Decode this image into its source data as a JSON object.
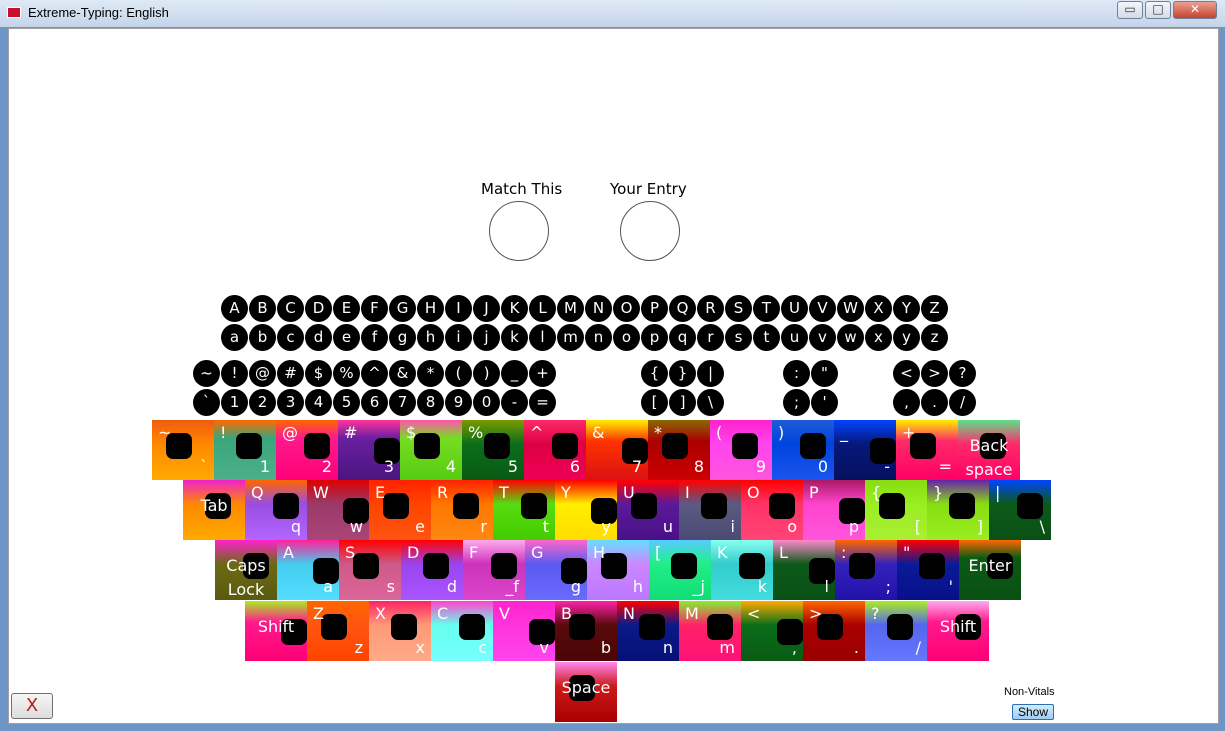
{
  "window": {
    "title": "Extreme-Typing: English",
    "minimize_label": "▭",
    "maximize_label": "□",
    "close_label": "✕"
  },
  "labels": {
    "match_this": "Match This",
    "your_entry": "Your Entry"
  },
  "reference_rows": {
    "upper": [
      "A",
      "B",
      "C",
      "D",
      "E",
      "F",
      "G",
      "H",
      "I",
      "J",
      "K",
      "L",
      "M",
      "N",
      "O",
      "P",
      "Q",
      "R",
      "S",
      "T",
      "U",
      "V",
      "W",
      "X",
      "Y",
      "Z"
    ],
    "lower": [
      "a",
      "b",
      "c",
      "d",
      "e",
      "f",
      "g",
      "h",
      "i",
      "j",
      "k",
      "l",
      "m",
      "n",
      "o",
      "p",
      "q",
      "r",
      "s",
      "t",
      "u",
      "v",
      "w",
      "x",
      "y",
      "z"
    ],
    "sym_shift": [
      "~",
      "!",
      "@",
      "#",
      "$",
      "%",
      "^",
      "&",
      "*",
      "(",
      ")",
      "_",
      "+"
    ],
    "sym_base": [
      "`",
      "1",
      "2",
      "3",
      "4",
      "5",
      "6",
      "7",
      "8",
      "9",
      "0",
      "-",
      "="
    ],
    "bracket_shift": [
      "{",
      "}",
      "|"
    ],
    "bracket_base": [
      "[",
      "]",
      "\\"
    ],
    "semi_shift": [
      ":",
      "\""
    ],
    "semi_base": [
      ";",
      "'"
    ],
    "comma_shift": [
      "<",
      ">",
      "?"
    ],
    "comma_base": [
      ",",
      ".",
      "/"
    ]
  },
  "keyboard_rows": [
    [
      {
        "shift": "~",
        "base": "`",
        "bg": "linear-gradient(180deg,#f05a10 0%,#ff8800 40%,#ffaa00 100%)"
      },
      {
        "shift": "!",
        "base": "1",
        "bg": "linear-gradient(180deg,#ff6a00 0%,#3aa57a 30%,#4cb08a 100%)"
      },
      {
        "shift": "@",
        "base": "2",
        "bg": "linear-gradient(180deg,#ff6600 0%,#ff1a8c 30%,#ff0077 100%)"
      },
      {
        "shift": "#",
        "base": "3",
        "bg": "linear-gradient(180deg,#ff3399 0%,#6a1fa0 30%,#4b1580 100%)"
      },
      {
        "shift": "$",
        "base": "4",
        "bg": "linear-gradient(180deg,#ff55aa 0%,#77dd22 30%,#55cc11 100%)"
      },
      {
        "shift": "%",
        "base": "5",
        "bg": "linear-gradient(180deg,#7a9a00 0%,#0b6e1a 40%,#0a5a14 100%)"
      },
      {
        "shift": "^",
        "base": "6",
        "bg": "linear-gradient(180deg,#ff2a6a 0%,#dd0044 40%,#ee0055 100%)"
      },
      {
        "shift": "&",
        "base": "7",
        "bg": "linear-gradient(180deg,#ffee00 0%,#ff3300 35%,#dd1111 100%)"
      },
      {
        "shift": "*",
        "base": "8",
        "bg": "linear-gradient(180deg,#8a6a00 0%,#aa0000 35%,#cc0000 100%)"
      },
      {
        "shift": "(",
        "base": "9",
        "bg": "linear-gradient(180deg,#ff22cc 0%,#ff44ee 40%,#ff55dd 100%)"
      },
      {
        "shift": ")",
        "base": "0",
        "bg": "linear-gradient(180deg,#1e5bd6 0%,#0044dd 40%,#1a55ee 100%)"
      },
      {
        "shift": "_",
        "base": "-",
        "bg": "linear-gradient(180deg,#0044ff 0%,#06187a 40%,#061060 100%)"
      },
      {
        "shift": "+",
        "base": "=",
        "bg": "linear-gradient(180deg,#ffee00 0%,#ff2a6a 35%,#ff0066 100%)"
      },
      {
        "label": "Back space",
        "bg": "linear-gradient(180deg,#5fe08a 0%,#ff2a6a 40%,#ff0066 100%)"
      }
    ],
    [
      {
        "label": "Tab",
        "bg": "linear-gradient(180deg,#ee22cc 0%,#ff8800 40%,#ffaa00 100%)"
      },
      {
        "shift": "Q",
        "base": "q",
        "bg": "linear-gradient(180deg,#ff6600 0%,#9a4de0 40%,#b266ff 100%)"
      },
      {
        "shift": "W",
        "base": "w",
        "bg": "linear-gradient(180deg,#dd0000 0%,#9a3a6a 40%,#aa4477 100%)"
      },
      {
        "shift": "E",
        "base": "e",
        "bg": "linear-gradient(180deg,#ff2200 0%,#ff4400 40%,#ff5511 100%)"
      },
      {
        "shift": "R",
        "base": "r",
        "bg": "linear-gradient(180deg,#ff2200 0%,#ff7700 40%,#ff8811 100%)"
      },
      {
        "shift": "T",
        "base": "t",
        "bg": "linear-gradient(180deg,#ff0000 0%,#55dd11 40%,#44cc00 100%)"
      },
      {
        "shift": "Y",
        "base": "y",
        "bg": "linear-gradient(180deg,#ff0000 0%,#ffee00 40%,#ffdd00 100%)"
      },
      {
        "shift": "U",
        "base": "u",
        "bg": "linear-gradient(180deg,#ff0000 0%,#5a1a99 40%,#4a1088 100%)"
      },
      {
        "shift": "I",
        "base": "i",
        "bg": "linear-gradient(180deg,#ff0000 0%,#5a5a82 40%,#4a4a72 100%)"
      },
      {
        "shift": "O",
        "base": "o",
        "bg": "linear-gradient(180deg,#ff0000 0%,#ff3366 40%,#ff4477 100%)"
      },
      {
        "shift": "P",
        "base": "p",
        "bg": "linear-gradient(180deg,#aa1a66 0%,#ff44cc 40%,#ff55dd 100%)"
      },
      {
        "shift": "{",
        "base": "[",
        "bg": "linear-gradient(180deg,#88dd11 0%,#99ee22 40%,#aaee33 100%)"
      },
      {
        "shift": "}",
        "base": "]",
        "bg": "linear-gradient(180deg,#6622aa 0%,#88dd11 40%,#99ee22 100%)"
      },
      {
        "shift": "|",
        "base": "\\",
        "bg": "linear-gradient(180deg,#0044ff 0%,#0b5a1a 40%,#0a5014 100%)"
      }
    ],
    [
      {
        "label": "Caps Lock",
        "bg": "linear-gradient(180deg,#ff22cc 0%,#6a6a14 40%,#5a5a10 100%)"
      },
      {
        "shift": "A",
        "base": "a",
        "bg": "linear-gradient(180deg,#ff2299 0%,#44ccee 40%,#55ddff 100%)"
      },
      {
        "shift": "S",
        "base": "s",
        "bg": "linear-gradient(180deg,#ff0000 0%,#cc5a88 40%,#dd6699 100%)"
      },
      {
        "shift": "D",
        "base": "d",
        "bg": "linear-gradient(180deg,#ff0000 0%,#9a44ee 40%,#aa55ff 100%)"
      },
      {
        "shift": "F",
        "base": "_f",
        "bg": "linear-gradient(180deg,#ffaaee 0%,#cc33bb 40%,#dd44cc 100%)"
      },
      {
        "shift": "G",
        "base": "g",
        "bg": "linear-gradient(180deg,#ff66cc 0%,#5a5aee 40%,#6a6aff 100%)"
      },
      {
        "shift": "H",
        "base": "h",
        "bg": "linear-gradient(180deg,#66ddff 0%,#cc88ff 40%,#bb77ff 100%)"
      },
      {
        "shift": "[",
        "base": "_j",
        "bg": "linear-gradient(180deg,#55ccff 0%,#22ee88 40%,#11dd77 100%)"
      },
      {
        "shift": "K",
        "base": "k",
        "bg": "linear-gradient(180deg,#88ffee 0%,#33cccc 40%,#44dddd 100%)"
      },
      {
        "shift": "L",
        "base": "l",
        "bg": "linear-gradient(180deg,#ff88cc 0%,#0b5a1a 40%,#0a5014 100%)"
      },
      {
        "shift": ":",
        "base": ";",
        "bg": "linear-gradient(180deg,#ff6600 0%,#3322bb 40%,#2211aa 100%)"
      },
      {
        "shift": "\"",
        "base": "'",
        "bg": "linear-gradient(180deg,#ff0000 0%,#0a1a99 40%,#081088 100%)"
      },
      {
        "label": "Enter",
        "bg": "linear-gradient(180deg,#ff6600 0%,#0a5a14 30%,#0a5014 100%)"
      }
    ],
    [
      {
        "label": "Shift",
        "bg": "linear-gradient(180deg,#aaee22 0%,#ff1a8c 35%,#ff0077 100%)"
      },
      {
        "shift": "Z",
        "base": "z",
        "bg": "linear-gradient(180deg,#ff6600 0%,#ff5511 40%,#ff4400 100%)"
      },
      {
        "shift": "X",
        "base": "x",
        "bg": "linear-gradient(180deg,#ff2266 0%,#ff9977 40%,#ffaa88 100%)"
      },
      {
        "shift": "C",
        "base": "c",
        "bg": "linear-gradient(180deg,#ff44cc 0%,#66ffee 40%,#77ffff 100%)"
      },
      {
        "shift": "V",
        "base": "v",
        "bg": "linear-gradient(180deg,#ff22cc 0%,#ff33dd 40%,#ff44ee 100%)"
      },
      {
        "shift": "B",
        "base": "b",
        "bg": "linear-gradient(180deg,#ff22aa 0%,#5a0a0a 40%,#4a0505 100%)"
      },
      {
        "shift": "N",
        "base": "n",
        "bg": "linear-gradient(180deg,#ff0000 0%,#0a1a88 40%,#081077 100%)"
      },
      {
        "shift": "M",
        "base": "m",
        "bg": "linear-gradient(180deg,#88ee33 0%,#ff2266 40%,#ff1177 100%)"
      },
      {
        "shift": "<",
        "base": ",",
        "bg": "linear-gradient(180deg,#ffaa00 0%,#0b6e1a 40%,#0a5a14 100%)"
      },
      {
        "shift": ">",
        "base": ".",
        "bg": "linear-gradient(180deg,#ff6600 0%,#aa0000 40%,#990000 100%)"
      },
      {
        "shift": "?",
        "base": "/",
        "bg": "linear-gradient(180deg,#aaee22 0%,#5566ee 40%,#6677ff 100%)"
      },
      {
        "label": "Shift",
        "bg": "linear-gradient(180deg,#ffaaee 0%,#ff1a8c 35%,#ff0077 100%)"
      }
    ],
    [
      {
        "label": "Space",
        "bg": "linear-gradient(180deg,#ff88ee 0%,#cc1a1a 40%,#aa0000 100%)"
      }
    ]
  ],
  "buttons": {
    "exit_label": "X",
    "show_label": "Show"
  },
  "non_vitals_label": "Non-Vitals"
}
